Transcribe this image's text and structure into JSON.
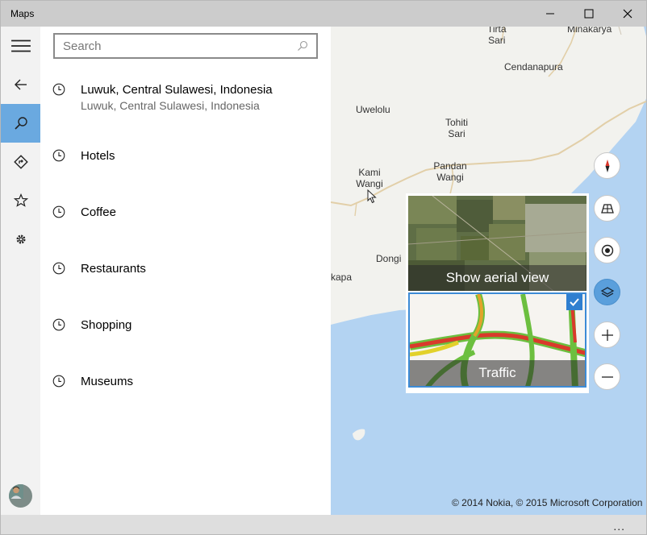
{
  "window": {
    "title": "Maps"
  },
  "search": {
    "placeholder": "Search",
    "value": ""
  },
  "recent": [
    {
      "primary": "Luwuk, Central Sulawesi, Indonesia",
      "secondary": "Luwuk, Central Sulawesi, Indonesia"
    },
    {
      "primary": "Hotels"
    },
    {
      "primary": "Coffee"
    },
    {
      "primary": "Restaurants"
    },
    {
      "primary": "Shopping"
    },
    {
      "primary": "Museums"
    }
  ],
  "map": {
    "labels": {
      "tirta_sari": "Tirta Sari",
      "minakarya": "Minakarya",
      "cendanapura": "Cendanapura",
      "uwelolu": "Uwelolu",
      "tohiti_sari": "Tohiti Sari",
      "pandan_wangi": "Pandan Wangi",
      "kami_wangi": "Kami Wangi",
      "dongi": "Dongi",
      "kapa": "kapa"
    },
    "layers": {
      "aerial_caption": "Show aerial view",
      "traffic_caption": "Traffic",
      "traffic_checked": true
    },
    "copyright": "© 2014 Nokia, © 2015 Microsoft Corporation"
  },
  "status": {
    "more": "..."
  },
  "colors": {
    "accent": "#5a9fdc",
    "water": "#b3d3f2",
    "land": "#f2f2ee",
    "road": "#e2cfa8"
  }
}
